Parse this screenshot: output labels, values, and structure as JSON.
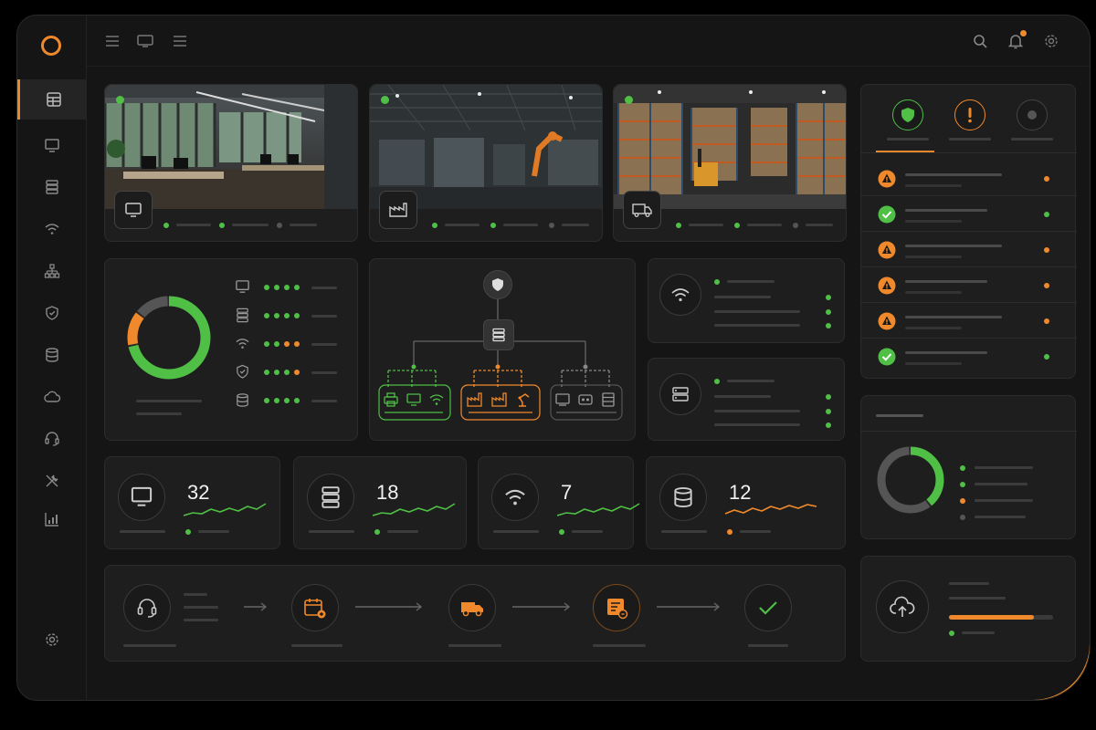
{
  "colors": {
    "accent": "#f0892c",
    "ok": "#4fbf45",
    "neutral": "#555555",
    "panel": "#1e1e1e"
  },
  "sidebar": {
    "items": [
      {
        "icon": "dashboard-icon",
        "active": true
      },
      {
        "icon": "monitor-icon"
      },
      {
        "icon": "server-icon"
      },
      {
        "icon": "wifi-icon"
      },
      {
        "icon": "network-icon"
      },
      {
        "icon": "shield-icon"
      },
      {
        "icon": "database-icon"
      },
      {
        "icon": "cloud-icon"
      },
      {
        "icon": "headset-icon"
      },
      {
        "icon": "tools-icon"
      },
      {
        "icon": "analytics-icon"
      }
    ],
    "footer_icon": "gear-icon"
  },
  "topbar": {
    "left_icons": [
      "menu-icon",
      "display-icon",
      "list-icon"
    ],
    "right_icons": [
      "search-icon",
      "bell-icon",
      "settings-icon"
    ]
  },
  "sites": [
    {
      "type": "office",
      "icon": "monitor-icon",
      "status": [
        "ok",
        "ok",
        "neutral"
      ]
    },
    {
      "type": "factory",
      "icon": "factory-icon",
      "status": [
        "ok",
        "ok",
        "neutral"
      ]
    },
    {
      "type": "warehouse",
      "icon": "truck-icon",
      "status": [
        "ok",
        "ok",
        "neutral"
      ]
    }
  ],
  "device_health": {
    "donut": [
      {
        "color": "ok",
        "value": 0.72
      },
      {
        "color": "accent",
        "value": 0.14
      },
      {
        "color": "neutral",
        "value": 0.14
      }
    ],
    "rows": [
      {
        "icon": "monitor-icon",
        "dots": [
          "ok",
          "ok",
          "ok",
          "ok"
        ]
      },
      {
        "icon": "server-icon",
        "dots": [
          "ok",
          "ok",
          "ok",
          "ok"
        ]
      },
      {
        "icon": "wifi-icon",
        "dots": [
          "ok",
          "ok",
          "accent",
          "accent"
        ]
      },
      {
        "icon": "shield-icon",
        "dots": [
          "ok",
          "ok",
          "ok",
          "accent"
        ]
      },
      {
        "icon": "database-icon",
        "dots": [
          "ok",
          "ok",
          "ok",
          "ok"
        ]
      }
    ]
  },
  "stats": [
    {
      "icon": "monitor-icon",
      "value": "32",
      "trend": "ok"
    },
    {
      "icon": "server-icon",
      "value": "18",
      "trend": "ok"
    },
    {
      "icon": "wifi-icon",
      "value": "7",
      "trend": "ok"
    },
    {
      "icon": "database-icon",
      "value": "12",
      "trend": "accent"
    }
  ],
  "alerts": {
    "tabs": [
      {
        "icon": "shield-check-icon",
        "color": "ok"
      },
      {
        "icon": "exclamation-icon",
        "color": "accent"
      },
      {
        "icon": "circle-icon",
        "color": "neutral"
      }
    ],
    "items": [
      {
        "icon": "warning-icon",
        "color": "accent"
      },
      {
        "icon": "check-icon",
        "color": "ok"
      },
      {
        "icon": "warning-icon",
        "color": "accent"
      },
      {
        "icon": "warning-icon",
        "color": "accent"
      },
      {
        "icon": "warning-icon",
        "color": "accent"
      },
      {
        "icon": "check-icon",
        "color": "ok"
      }
    ]
  },
  "capacity": {
    "donut": [
      {
        "color": "ok",
        "value": 0.4
      },
      {
        "color": "neutral",
        "value": 0.6
      }
    ],
    "legend": [
      "ok",
      "ok",
      "accent",
      "neutral"
    ]
  },
  "upload": {
    "progress": 0.82
  },
  "workflow": {
    "steps": [
      "headset-icon",
      "calendar-icon",
      "van-icon",
      "invoice-icon",
      "check-icon"
    ]
  }
}
